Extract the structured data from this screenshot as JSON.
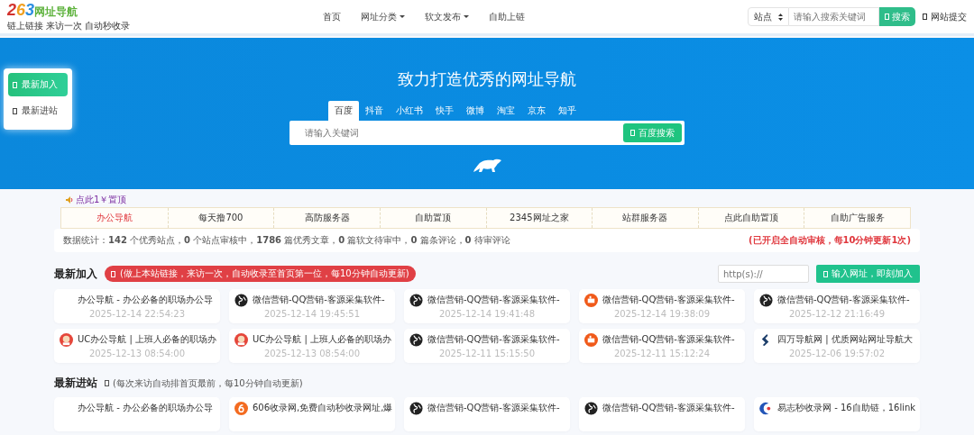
{
  "header": {
    "logo_digits": "263",
    "logo_text": "网址导航",
    "tagline": "链上链接 来访一次 自动秒收录",
    "nav": [
      {
        "label": "首页",
        "dropdown": false
      },
      {
        "label": "网址分类",
        "dropdown": true
      },
      {
        "label": "软文发布",
        "dropdown": true
      },
      {
        "label": "自助上链",
        "dropdown": false
      }
    ],
    "search": {
      "scope": "站点",
      "placeholder": "请输入搜索关键词",
      "button": "搜索"
    },
    "submit_link": "网站提交"
  },
  "side_menu": [
    {
      "label": "最新加入",
      "selected": true
    },
    {
      "label": "最新进站",
      "selected": false
    }
  ],
  "hero": {
    "title": "致力打造优秀的网址导航",
    "tabs": [
      {
        "label": "百度",
        "selected": true
      },
      {
        "label": "抖音",
        "selected": false
      },
      {
        "label": "小红书",
        "selected": false
      },
      {
        "label": "快手",
        "selected": false
      },
      {
        "label": "微博",
        "selected": false
      },
      {
        "label": "淘宝",
        "selected": false
      },
      {
        "label": "京东",
        "selected": false
      },
      {
        "label": "知乎",
        "selected": false
      }
    ],
    "placeholder": "请输入关键词",
    "button": "百度搜索"
  },
  "notice": "点此1￥置顶",
  "links": [
    {
      "label": "办公导航",
      "hot": true
    },
    {
      "label": "每天撸700",
      "hot": false
    },
    {
      "label": "高防服务器",
      "hot": false
    },
    {
      "label": "自助置顶",
      "hot": false
    },
    {
      "label": "2345网址之家",
      "hot": false
    },
    {
      "label": "站群服务器",
      "hot": false
    },
    {
      "label": "点此自助置顶",
      "hot": false
    },
    {
      "label": "自助广告服务",
      "hot": false
    }
  ],
  "stats": {
    "text": "数据统计：**142** 个优秀站点，**0** 个站点审核中，**1786** 篇优秀文章，**0** 篇软文待审中，**0** 篇条评论，**0** 待审评论",
    "notice": "(已开启全自动审核，每10分钟更新1次)"
  },
  "latest_added": {
    "title": "最新加入",
    "badge": "(做上本站链接，来访一次，自动收录至首页第一位，每10分钟自动更新)",
    "url_placeholder": "http(s)://",
    "button": "输入网址，即刻加入",
    "cards": [
      {
        "kind": "plain",
        "title": "办公导航 - 办公必备的职场办公导",
        "time": "2025-12-14 22:54:23"
      },
      {
        "kind": "globe",
        "title": "微信营销-QQ营销-客源采集软件-",
        "time": "2025-12-14 19:45:51"
      },
      {
        "kind": "globe",
        "title": "微信营销-QQ营销-客源采集软件-",
        "time": "2025-12-14 19:41:48"
      },
      {
        "kind": "orange",
        "title": "微信营销-QQ营销-客源采集软件-",
        "time": "2025-12-14 19:38:09"
      },
      {
        "kind": "globe",
        "title": "微信营销-QQ营销-客源采集软件-",
        "time": "2025-12-12 21:16:49"
      },
      {
        "kind": "avatar",
        "title": "UC办公导航 | 上班人必备的职场办",
        "time": "2025-12-13 08:54:00"
      },
      {
        "kind": "avatar",
        "title": "UC办公导航 | 上班人必备的职场办",
        "time": "2025-12-13 08:54:00"
      },
      {
        "kind": "globe",
        "title": "微信营销-QQ营销-客源采集软件-",
        "time": "2025-12-11 15:15:50"
      },
      {
        "kind": "orange",
        "title": "微信营销-QQ营销-客源采集软件-",
        "time": "2025-12-11 15:12:24"
      },
      {
        "kind": "chevron",
        "title": "四万导航网 | 优质网站网址导航大",
        "time": "2025-12-06 19:57:02"
      }
    ]
  },
  "latest_visited": {
    "title": "最新进站",
    "note": "(每次来访自动排首页最前，每10分钟自动更新)",
    "cards": [
      {
        "kind": "plain",
        "title": "办公导航 - 办公必备的职场办公导"
      },
      {
        "kind": "six",
        "title": "606收录网,免费自动秒收录网址,爆"
      },
      {
        "kind": "globe",
        "title": "微信营销-QQ营销-客源采集软件-"
      },
      {
        "kind": "globe",
        "title": "微信营销-QQ营销-客源采集软件-"
      },
      {
        "kind": "crescent",
        "title": "易志秒收录网 - 16自助链，16link"
      }
    ]
  }
}
